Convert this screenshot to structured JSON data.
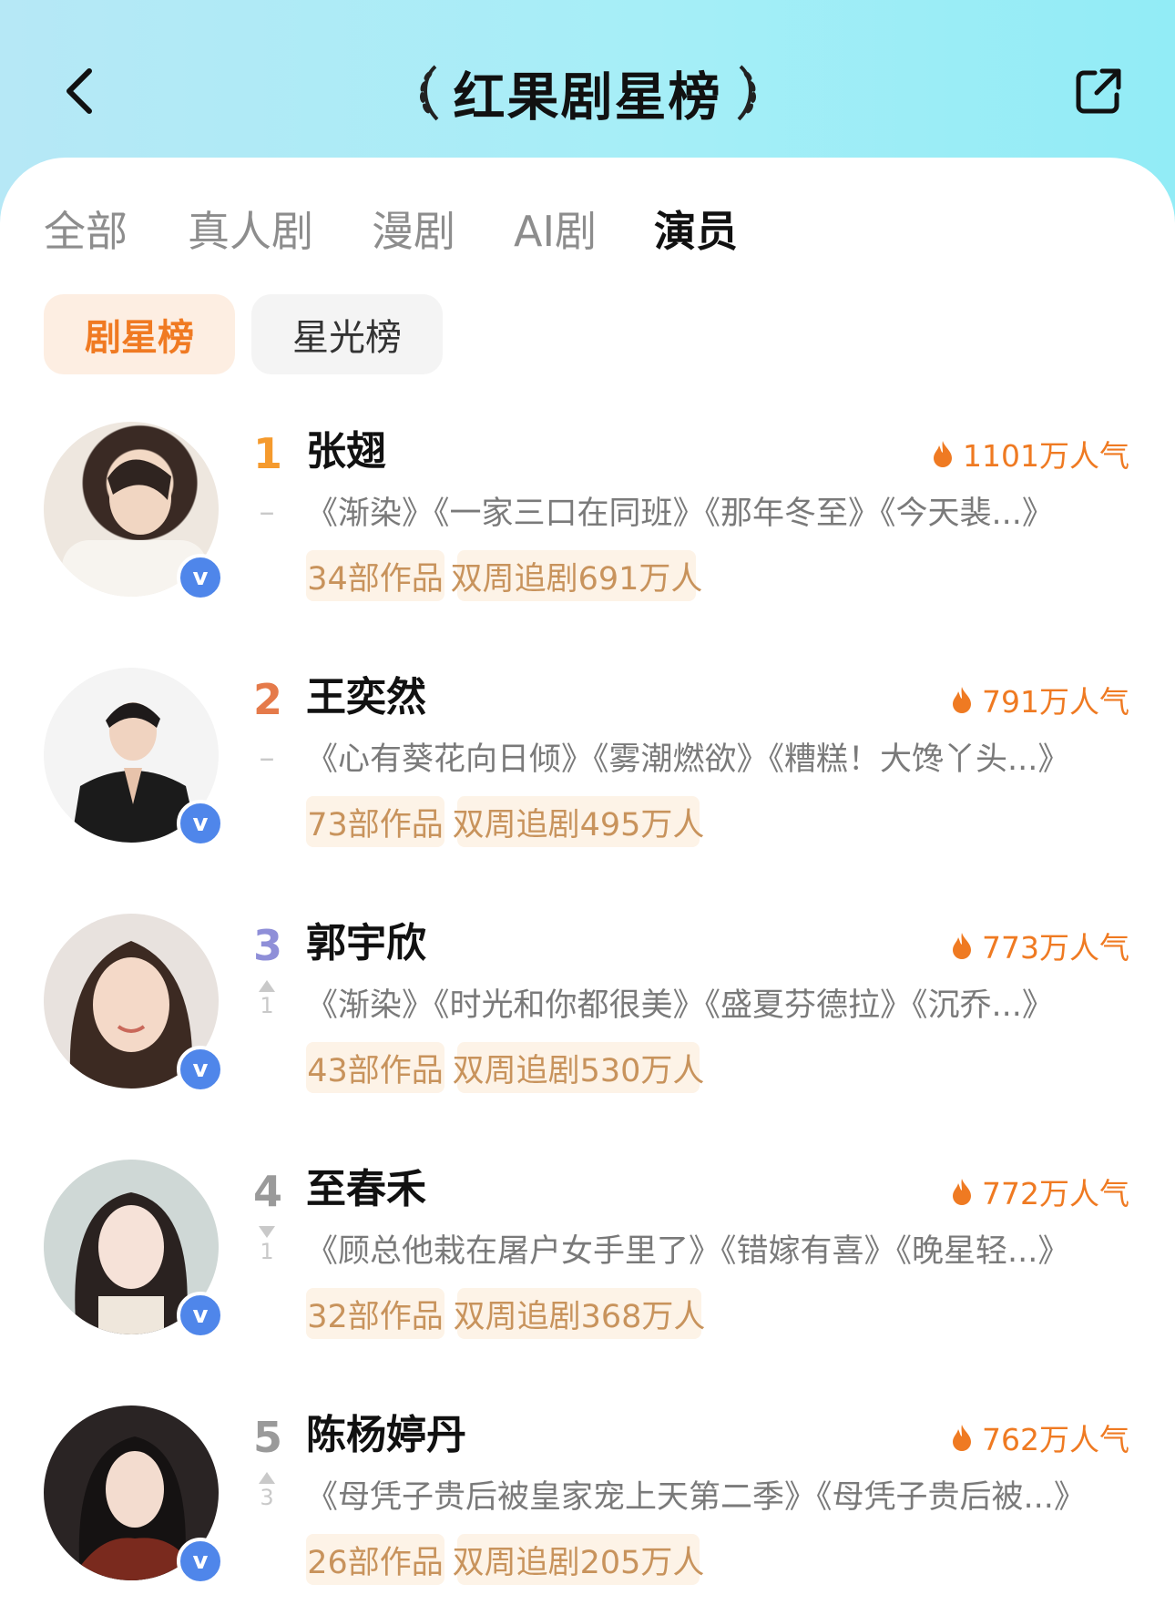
{
  "header": {
    "title": "红果剧星榜",
    "back_icon": "chevron-left-icon",
    "share_icon": "share-icon"
  },
  "tabs": [
    {
      "label": "全部",
      "active": false
    },
    {
      "label": "真人剧",
      "active": false
    },
    {
      "label": "漫剧",
      "active": false
    },
    {
      "label": "AI剧",
      "active": false
    },
    {
      "label": "演员",
      "active": true
    }
  ],
  "subtabs": [
    {
      "label": "剧星榜",
      "active": true
    },
    {
      "label": "星光榜",
      "active": false
    }
  ],
  "colors": {
    "accent_orange": "#ef7a22",
    "rank1": "#f59a2d",
    "rank2": "#e57a4a",
    "rank3": "#8f8fd8",
    "rank_default": "#9a9a9a",
    "tag_bg": "#fdf3e7",
    "tag_text": "#c8935c",
    "verified_badge": "#4f86ea"
  },
  "actors": [
    {
      "rank": "1",
      "name": "张翅",
      "popularity": "1101万人气",
      "trend": {
        "type": "same",
        "symbol": "–",
        "value": ""
      },
      "works": "《渐染》《一家三口在同班》《那年冬至》《今天裴...》",
      "tags": [
        "34部作品",
        "双周追剧691万人"
      ],
      "badge": "v"
    },
    {
      "rank": "2",
      "name": "王奕然",
      "popularity": "791万人气",
      "trend": {
        "type": "same",
        "symbol": "–",
        "value": ""
      },
      "works": "《心有葵花向日倾》《雾潮燃欲》《糟糕！大馋丫头...》",
      "tags": [
        "73部作品",
        "双周追剧495万人"
      ],
      "badge": "v"
    },
    {
      "rank": "3",
      "name": "郭宇欣",
      "popularity": "773万人气",
      "trend": {
        "type": "up",
        "symbol": "",
        "value": "1"
      },
      "works": "《渐染》《时光和你都很美》《盛夏芬德拉》《沉乔...》",
      "tags": [
        "43部作品",
        "双周追剧530万人"
      ],
      "badge": "v"
    },
    {
      "rank": "4",
      "name": "至春禾",
      "popularity": "772万人气",
      "trend": {
        "type": "down",
        "symbol": "",
        "value": "1"
      },
      "works": "《顾总他栽在屠户女手里了》《错嫁有喜》《晚星轻...》",
      "tags": [
        "32部作品",
        "双周追剧368万人"
      ],
      "badge": "v"
    },
    {
      "rank": "5",
      "name": "陈杨婷丹",
      "popularity": "762万人气",
      "trend": {
        "type": "up",
        "symbol": "",
        "value": "3"
      },
      "works": "《母凭子贵后被皇家宠上天第二季》《母凭子贵后被...》",
      "tags": [
        "26部作品",
        "双周追剧205万人"
      ],
      "badge": "v"
    }
  ]
}
